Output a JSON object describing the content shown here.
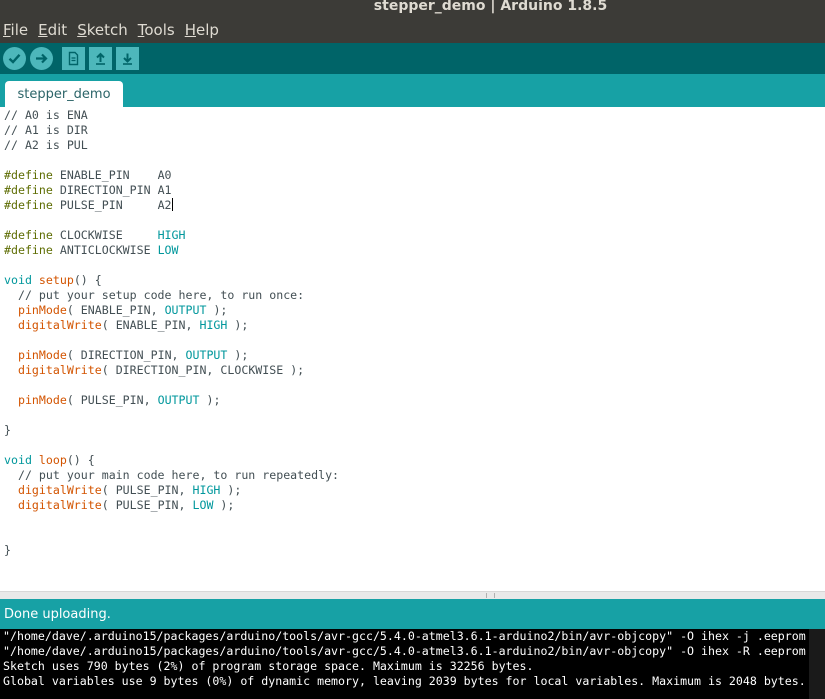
{
  "window": {
    "title": "stepper_demo | Arduino 1.8.5"
  },
  "menu": [
    {
      "accel": "F",
      "rest": "ile"
    },
    {
      "accel": "E",
      "rest": "dit"
    },
    {
      "accel": "S",
      "rest": "ketch"
    },
    {
      "accel": "T",
      "rest": "ools"
    },
    {
      "accel": "H",
      "rest": "elp"
    }
  ],
  "toolbar": {
    "verify_icon": "check-icon",
    "upload_icon": "arrow-right-icon",
    "new_icon": "new-file-icon",
    "open_icon": "arrow-up-icon",
    "save_icon": "arrow-down-icon"
  },
  "tabs": [
    {
      "label": "stepper_demo"
    }
  ],
  "editor": {
    "lines": [
      "// A0 is ENA",
      "// A1 is DIR",
      "// A2 is PUL",
      "",
      "#define ENABLE_PIN    A0",
      "#define DIRECTION_PIN A1",
      "#define PULSE_PIN     A2",
      "",
      "#define CLOCKWISE     HIGH",
      "#define ANTICLOCKWISE LOW",
      "",
      "void setup() {",
      "  // put your setup code here, to run once:",
      "  pinMode( ENABLE_PIN, OUTPUT );",
      "  digitalWrite( ENABLE_PIN, HIGH );",
      "",
      "  pinMode( DIRECTION_PIN, OUTPUT );",
      "  digitalWrite( DIRECTION_PIN, CLOCKWISE );",
      "",
      "  pinMode( PULSE_PIN, OUTPUT );",
      "",
      "}",
      "",
      "void loop() {",
      "  // put your main code here, to run repeatedly:",
      "  digitalWrite( PULSE_PIN, HIGH );",
      "  digitalWrite( PULSE_PIN, LOW );",
      "",
      "",
      "}"
    ]
  },
  "status": {
    "message": "Done uploading."
  },
  "console": {
    "lines": [
      "\"/home/dave/.arduino15/packages/arduino/tools/avr-gcc/5.4.0-atmel3.6.1-arduino2/bin/avr-objcopy\" -O ihex -j .eeprom --",
      "\"/home/dave/.arduino15/packages/arduino/tools/avr-gcc/5.4.0-atmel3.6.1-arduino2/bin/avr-objcopy\" -O ihex -R .eeprom  \"",
      "Sketch uses 790 bytes (2%) of program storage space. Maximum is 32256 bytes.",
      "Global variables use 9 bytes (0%) of dynamic memory, leaving 2039 bytes for local variables. Maximum is 2048 bytes."
    ]
  },
  "colors": {
    "toolbar": "#006468",
    "tabbar": "#17a1a5",
    "button": "#4db7bb",
    "preprocessor": "#5e6d03",
    "function": "#d35400",
    "constant": "#00979c"
  }
}
